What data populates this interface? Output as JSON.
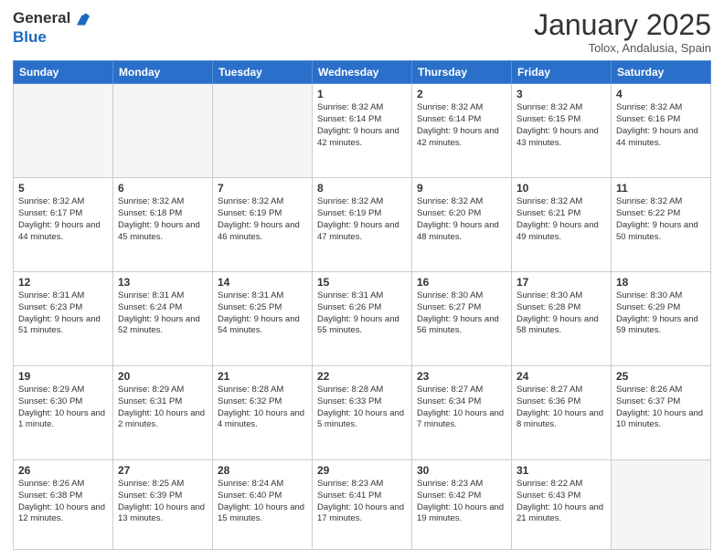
{
  "logo": {
    "line1": "General",
    "line2": "Blue"
  },
  "header": {
    "month": "January 2025",
    "location": "Tolox, Andalusia, Spain"
  },
  "weekdays": [
    "Sunday",
    "Monday",
    "Tuesday",
    "Wednesday",
    "Thursday",
    "Friday",
    "Saturday"
  ],
  "weeks": [
    [
      {
        "day": "",
        "info": ""
      },
      {
        "day": "",
        "info": ""
      },
      {
        "day": "",
        "info": ""
      },
      {
        "day": "1",
        "info": "Sunrise: 8:32 AM\nSunset: 6:14 PM\nDaylight: 9 hours and 42 minutes."
      },
      {
        "day": "2",
        "info": "Sunrise: 8:32 AM\nSunset: 6:14 PM\nDaylight: 9 hours and 42 minutes."
      },
      {
        "day": "3",
        "info": "Sunrise: 8:32 AM\nSunset: 6:15 PM\nDaylight: 9 hours and 43 minutes."
      },
      {
        "day": "4",
        "info": "Sunrise: 8:32 AM\nSunset: 6:16 PM\nDaylight: 9 hours and 44 minutes."
      }
    ],
    [
      {
        "day": "5",
        "info": "Sunrise: 8:32 AM\nSunset: 6:17 PM\nDaylight: 9 hours and 44 minutes."
      },
      {
        "day": "6",
        "info": "Sunrise: 8:32 AM\nSunset: 6:18 PM\nDaylight: 9 hours and 45 minutes."
      },
      {
        "day": "7",
        "info": "Sunrise: 8:32 AM\nSunset: 6:19 PM\nDaylight: 9 hours and 46 minutes."
      },
      {
        "day": "8",
        "info": "Sunrise: 8:32 AM\nSunset: 6:19 PM\nDaylight: 9 hours and 47 minutes."
      },
      {
        "day": "9",
        "info": "Sunrise: 8:32 AM\nSunset: 6:20 PM\nDaylight: 9 hours and 48 minutes."
      },
      {
        "day": "10",
        "info": "Sunrise: 8:32 AM\nSunset: 6:21 PM\nDaylight: 9 hours and 49 minutes."
      },
      {
        "day": "11",
        "info": "Sunrise: 8:32 AM\nSunset: 6:22 PM\nDaylight: 9 hours and 50 minutes."
      }
    ],
    [
      {
        "day": "12",
        "info": "Sunrise: 8:31 AM\nSunset: 6:23 PM\nDaylight: 9 hours and 51 minutes."
      },
      {
        "day": "13",
        "info": "Sunrise: 8:31 AM\nSunset: 6:24 PM\nDaylight: 9 hours and 52 minutes."
      },
      {
        "day": "14",
        "info": "Sunrise: 8:31 AM\nSunset: 6:25 PM\nDaylight: 9 hours and 54 minutes."
      },
      {
        "day": "15",
        "info": "Sunrise: 8:31 AM\nSunset: 6:26 PM\nDaylight: 9 hours and 55 minutes."
      },
      {
        "day": "16",
        "info": "Sunrise: 8:30 AM\nSunset: 6:27 PM\nDaylight: 9 hours and 56 minutes."
      },
      {
        "day": "17",
        "info": "Sunrise: 8:30 AM\nSunset: 6:28 PM\nDaylight: 9 hours and 58 minutes."
      },
      {
        "day": "18",
        "info": "Sunrise: 8:30 AM\nSunset: 6:29 PM\nDaylight: 9 hours and 59 minutes."
      }
    ],
    [
      {
        "day": "19",
        "info": "Sunrise: 8:29 AM\nSunset: 6:30 PM\nDaylight: 10 hours and 1 minute."
      },
      {
        "day": "20",
        "info": "Sunrise: 8:29 AM\nSunset: 6:31 PM\nDaylight: 10 hours and 2 minutes."
      },
      {
        "day": "21",
        "info": "Sunrise: 8:28 AM\nSunset: 6:32 PM\nDaylight: 10 hours and 4 minutes."
      },
      {
        "day": "22",
        "info": "Sunrise: 8:28 AM\nSunset: 6:33 PM\nDaylight: 10 hours and 5 minutes."
      },
      {
        "day": "23",
        "info": "Sunrise: 8:27 AM\nSunset: 6:34 PM\nDaylight: 10 hours and 7 minutes."
      },
      {
        "day": "24",
        "info": "Sunrise: 8:27 AM\nSunset: 6:36 PM\nDaylight: 10 hours and 8 minutes."
      },
      {
        "day": "25",
        "info": "Sunrise: 8:26 AM\nSunset: 6:37 PM\nDaylight: 10 hours and 10 minutes."
      }
    ],
    [
      {
        "day": "26",
        "info": "Sunrise: 8:26 AM\nSunset: 6:38 PM\nDaylight: 10 hours and 12 minutes."
      },
      {
        "day": "27",
        "info": "Sunrise: 8:25 AM\nSunset: 6:39 PM\nDaylight: 10 hours and 13 minutes."
      },
      {
        "day": "28",
        "info": "Sunrise: 8:24 AM\nSunset: 6:40 PM\nDaylight: 10 hours and 15 minutes."
      },
      {
        "day": "29",
        "info": "Sunrise: 8:23 AM\nSunset: 6:41 PM\nDaylight: 10 hours and 17 minutes."
      },
      {
        "day": "30",
        "info": "Sunrise: 8:23 AM\nSunset: 6:42 PM\nDaylight: 10 hours and 19 minutes."
      },
      {
        "day": "31",
        "info": "Sunrise: 8:22 AM\nSunset: 6:43 PM\nDaylight: 10 hours and 21 minutes."
      },
      {
        "day": "",
        "info": ""
      }
    ]
  ]
}
